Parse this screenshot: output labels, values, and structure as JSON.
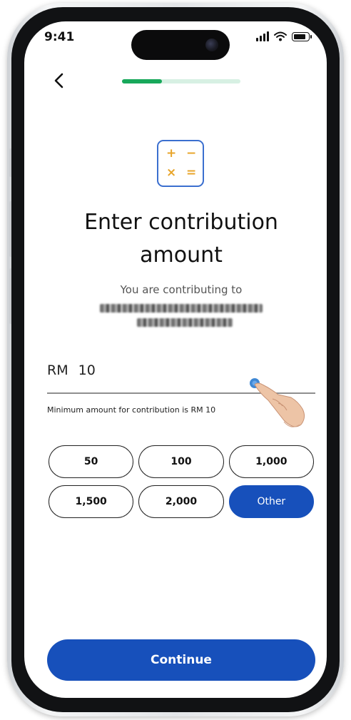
{
  "status_bar": {
    "time": "9:41"
  },
  "header": {
    "back_icon": "chevron-left-icon",
    "progress": 0.34
  },
  "hero": {
    "icon": "calculator-icon",
    "title_line1": "Enter contribution",
    "title_line2": "amount"
  },
  "subtitle": "You are contributing to",
  "amount_input": {
    "currency": "RM",
    "value": "10"
  },
  "hint": "Minimum amount for contribution is RM 10",
  "amount_options": [
    "50",
    "100",
    "1,000",
    "1,500",
    "2,000",
    "Other"
  ],
  "selected_option": "Other",
  "continue_label": "Continue",
  "colors": {
    "primary": "#1750bb",
    "progress": "#18a85b",
    "progress_track": "#d7f0e3",
    "icon_accent": "#e8a52b"
  }
}
